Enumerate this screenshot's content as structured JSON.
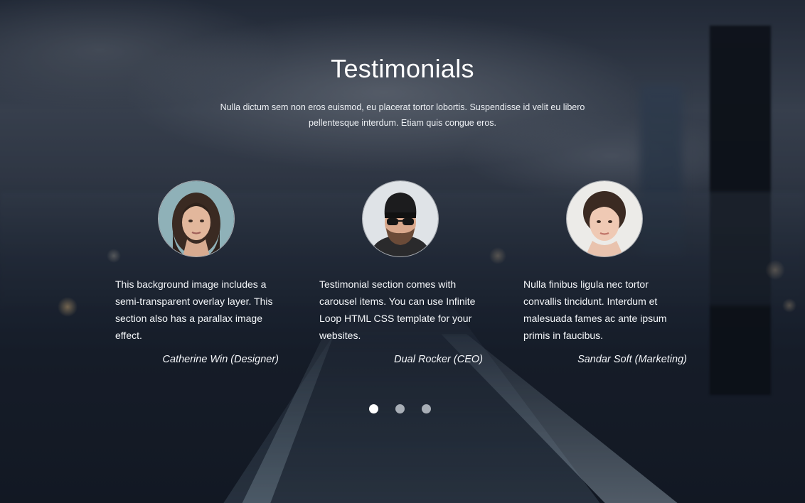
{
  "section": {
    "title": "Testimonials",
    "intro": "Nulla dictum sem non eros euismod, eu placerat tortor lobortis. Suspendisse id velit eu libero pellentesque interdum. Etiam quis congue eros."
  },
  "testimonials": [
    {
      "quote": "This background image includes a semi-transparent overlay layer. This section also has a parallax image effect.",
      "author": "Catherine Win (Designer)"
    },
    {
      "quote": "Testimonial section comes with carousel items. You can use Infinite Loop HTML CSS template for your websites.",
      "author": "Dual Rocker (CEO)"
    },
    {
      "quote": "Nulla finibus ligula nec tortor convallis tincidunt. Interdum et malesuada fames ac ante ipsum primis in faucibus.",
      "author": "Sandar Soft (Marketing)"
    }
  ],
  "carousel": {
    "page_count": 3,
    "active_page": 1
  },
  "colors": {
    "text": "#ffffff",
    "dot_active": "#ffffff",
    "dot_inactive": "#a8aeb6"
  }
}
